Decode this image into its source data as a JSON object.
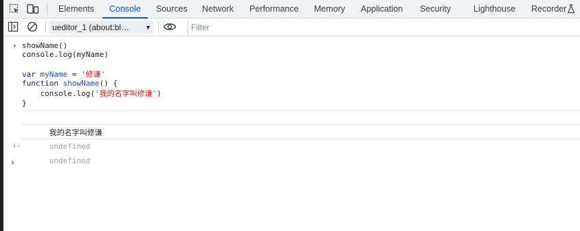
{
  "devtools": {
    "tabs": [
      {
        "label": "Elements"
      },
      {
        "label": "Console"
      },
      {
        "label": "Sources"
      },
      {
        "label": "Network"
      },
      {
        "label": "Performance"
      },
      {
        "label": "Memory"
      },
      {
        "label": "Application"
      },
      {
        "label": "Security"
      },
      {
        "label": "Lighthouse"
      },
      {
        "label": "Recorder"
      }
    ],
    "active_tab": "Console",
    "icons": {
      "inspect": "inspect-element-icon",
      "device": "device-toolbar-icon",
      "recorder": "flask-icon",
      "sidebar": "sidebar-toggle-icon",
      "clear": "clear-console-icon",
      "eye": "live-expression-icon"
    },
    "accent_color": "#0b57d0"
  },
  "toolbar": {
    "context_select": "ueditor_1 (about:bl…",
    "filter_placeholder": "Filter"
  },
  "console": {
    "prompt_symbol": "›",
    "input_lines": [
      "showName()",
      "console.log(myName)",
      "",
      "var myName = '修谦'",
      "function showName() {",
      "    console.log('我的名字叫修谦')",
      "}"
    ],
    "log_output": "我的名字叫修谦",
    "undefined_log": "undefined",
    "result_symbol": "‹·",
    "result_value": "undefined",
    "caret_symbol": "›"
  }
}
